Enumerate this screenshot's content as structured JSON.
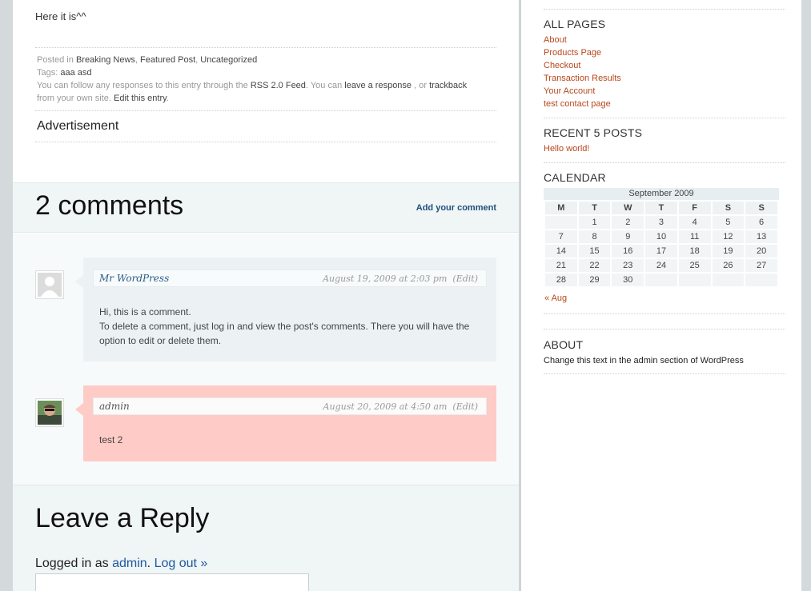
{
  "post": {
    "text": "Here it is^^",
    "posted_in_label": "Posted in",
    "categories": [
      "Breaking News",
      "Featured Post",
      "Uncategorized"
    ],
    "tags_label": "Tags:",
    "tags": [
      "aaa",
      "asd"
    ],
    "follow_prefix": "You can follow any responses to this entry through the",
    "rss_link": "RSS 2.0 Feed",
    "you_can": ". You can",
    "leave_response": "leave a response",
    "or_text": ", or",
    "trackback": "trackback",
    "from_site": "from your own site.",
    "edit_entry": "Edit this entry",
    "advertisement": "Advertisement"
  },
  "comments_section": {
    "heading": "2 comments",
    "add_comment": "Add your comment",
    "comments": [
      {
        "author": "Mr WordPress",
        "date": "August 19, 2009 at 2:03 pm",
        "edit": "(Edit)",
        "body_line1": "Hi, this is a comment.",
        "body_line2": "To delete a comment, just log in and view the post's comments. There you will have the option to edit or delete them.",
        "bg_color": "#ecf2f3"
      },
      {
        "author": "admin",
        "date": "August 20, 2009 at 4:50 am",
        "edit": "(Edit)",
        "body_line1": "test 2",
        "bg_color": "#ffcbc6"
      }
    ]
  },
  "reply": {
    "heading": "Leave a Reply",
    "logged_in_as": "Logged in as",
    "user": "admin",
    "logout": "Log out »"
  },
  "sidebar": {
    "all_pages_title": "ALL PAGES",
    "pages": [
      "About",
      "Products Page",
      "Checkout",
      "Transaction Results",
      "Your Account",
      "test contact page"
    ],
    "recent_title": "RECENT 5 POSTS",
    "recent_posts": [
      "Hello world!"
    ],
    "calendar_title": "CALENDAR",
    "calendar": {
      "caption": "September 2009",
      "days": [
        "M",
        "T",
        "W",
        "T",
        "F",
        "S",
        "S"
      ],
      "weeks": [
        [
          "",
          "1",
          "2",
          "3",
          "4",
          "5",
          "6"
        ],
        [
          "7",
          "8",
          "9",
          "10",
          "11",
          "12",
          "13"
        ],
        [
          "14",
          "15",
          "16",
          "17",
          "18",
          "19",
          "20"
        ],
        [
          "21",
          "22",
          "23",
          "24",
          "25",
          "26",
          "27"
        ],
        [
          "28",
          "29",
          "30",
          "",
          "",
          "",
          ""
        ]
      ],
      "prev": "« Aug"
    },
    "about_title": "ABOUT",
    "about_text": "Change this text in the admin section of WordPress"
  },
  "colors": {
    "link_orange": "#b8471c",
    "link_blue": "#21507a",
    "highlight_pink": "#ffcbc6"
  }
}
